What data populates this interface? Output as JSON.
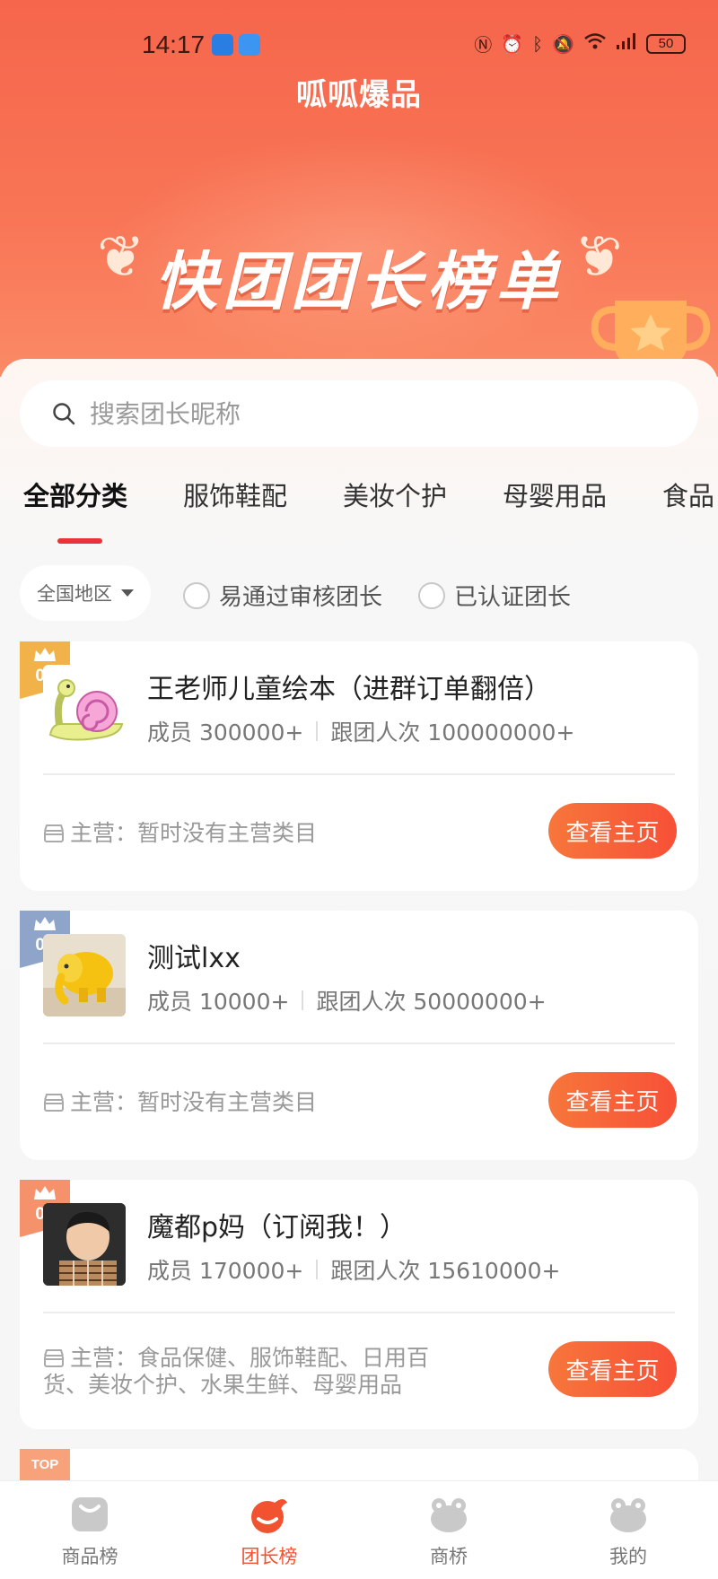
{
  "status_bar": {
    "time": "14:17",
    "battery": "50"
  },
  "app_title": "呱呱爆品",
  "banner_title": "快团团长榜单",
  "search": {
    "placeholder": "搜索团长昵称"
  },
  "tabs": [
    {
      "label": "全部分类",
      "active": true
    },
    {
      "label": "服饰鞋配",
      "active": false
    },
    {
      "label": "美妆个护",
      "active": false
    },
    {
      "label": "母婴用品",
      "active": false
    },
    {
      "label": "食品",
      "active": false
    }
  ],
  "filters": {
    "region": "全国地区",
    "options": [
      {
        "label": "易通过审核团长",
        "checked": false
      },
      {
        "label": "已认证团长",
        "checked": false
      }
    ]
  },
  "leaders": [
    {
      "rank": "01",
      "name": "王老师儿童绘本（进群订单翻倍）",
      "members": "成员 300000+",
      "followers": "跟团人次 100000000+",
      "main_label": "主营：",
      "main_value": "暂时没有主营类目",
      "button": "查看主页",
      "badge_color": "#f2b24a"
    },
    {
      "rank": "02",
      "name": "测试lxx",
      "members": "成员 10000+",
      "followers": "跟团人次 50000000+",
      "main_label": "主营：",
      "main_value": "暂时没有主营类目",
      "button": "查看主页",
      "badge_color": "#8fa4c9"
    },
    {
      "rank": "03",
      "name": "魔都p妈（订阅我！）",
      "members": "成员 170000+",
      "followers": "跟团人次 15610000+",
      "main_label": "主营：",
      "main_value": "食品保健、服饰鞋配、日用百货、美妆个护、水果生鲜、母婴用品",
      "button": "查看主页",
      "badge_color": "#f5916b"
    }
  ],
  "partial_badge": "TOP",
  "bottom_nav": [
    {
      "label": "商品榜",
      "icon": "bag-icon",
      "active": false
    },
    {
      "label": "团长榜",
      "icon": "leader-icon",
      "active": true
    },
    {
      "label": "商桥",
      "icon": "frog-icon",
      "active": false
    },
    {
      "label": "我的",
      "icon": "frog-icon",
      "active": false
    }
  ],
  "colors": {
    "accent": "#f2522f",
    "button": "#f75037",
    "hero": "#f6664c"
  }
}
